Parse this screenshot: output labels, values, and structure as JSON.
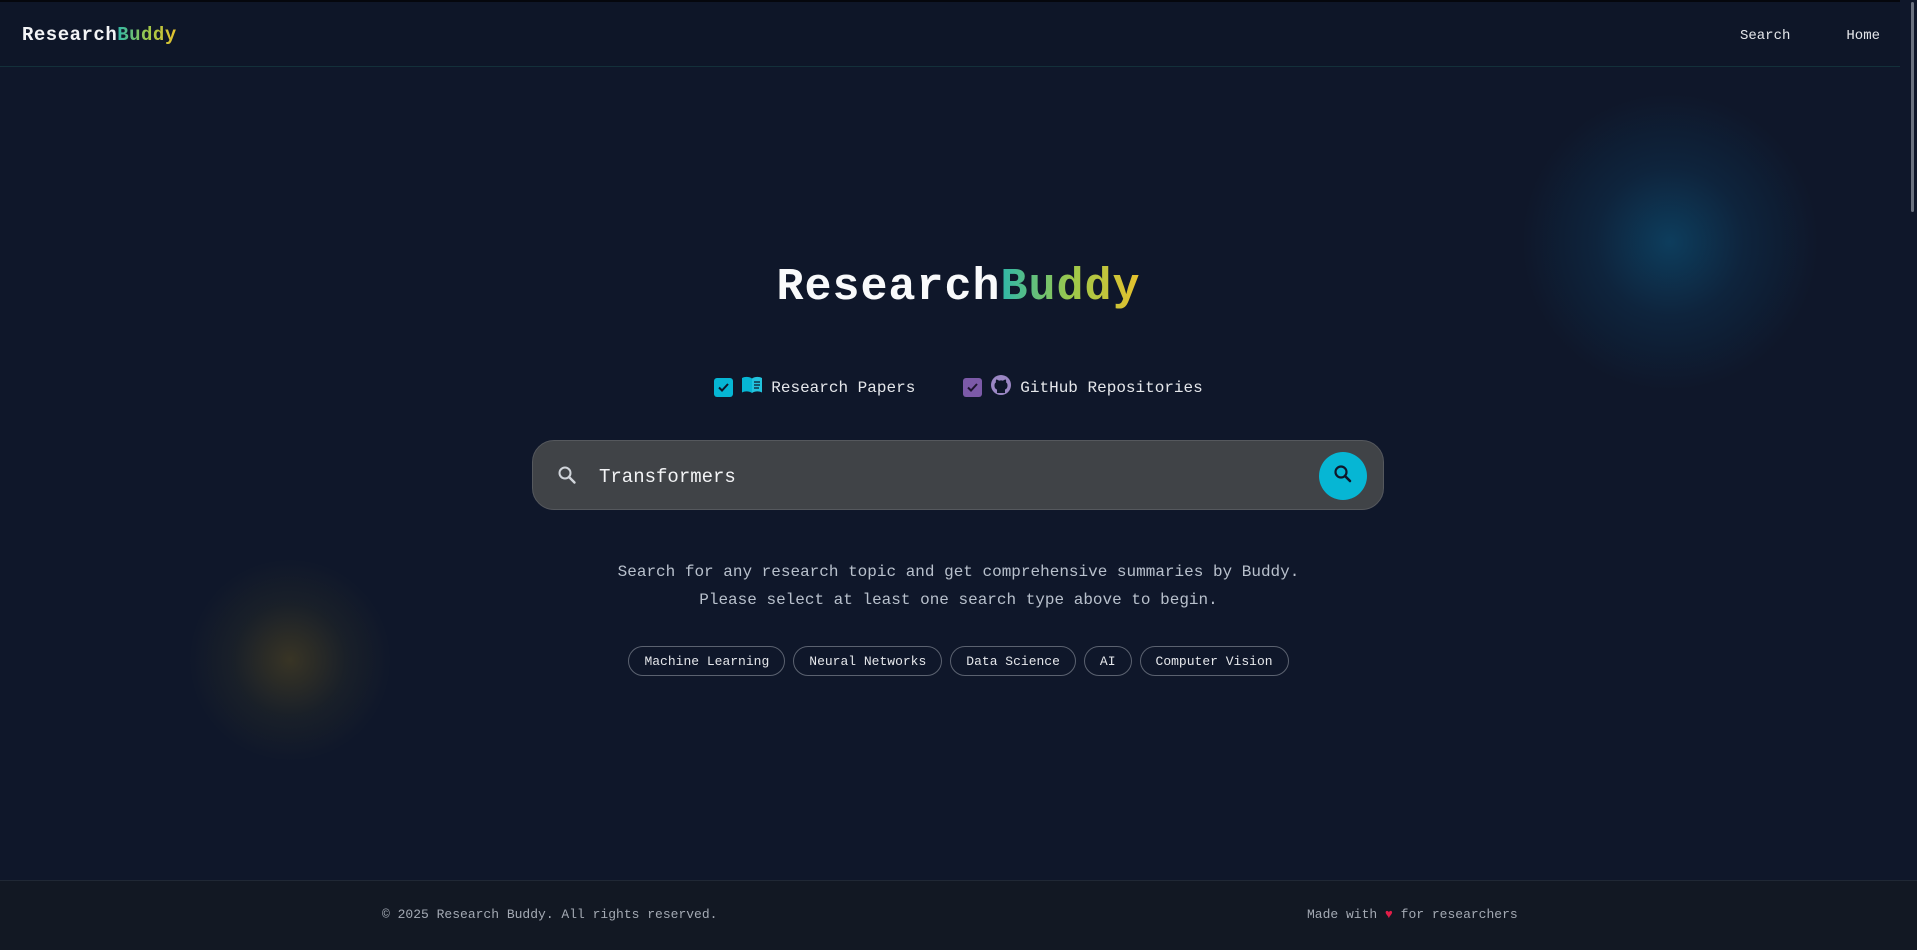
{
  "header": {
    "brand_part1": "Research",
    "brand_part2": "Buddy",
    "nav": [
      "Search",
      "Home"
    ]
  },
  "hero": {
    "title_part1": "Research",
    "title_part2": "Buddy"
  },
  "filters": [
    {
      "label": "Research Papers",
      "checked": true,
      "icon": "book-icon",
      "color": "#06b6d4"
    },
    {
      "label": "GitHub Repositories",
      "checked": true,
      "icon": "github-icon",
      "color": "#7c5aa8"
    }
  ],
  "search": {
    "value": "Transformers",
    "icon": "search-icon",
    "button_icon": "search-icon"
  },
  "description": [
    "Search for any research topic and get comprehensive summaries by Buddy.",
    "Please select at least one search type above to begin."
  ],
  "suggestions": [
    "Machine Learning",
    "Neural Networks",
    "Data Science",
    "AI",
    "Computer Vision"
  ],
  "footer": {
    "copyright": "© 2025 Research Buddy. All rights reserved.",
    "made_with_prefix": "Made with",
    "heart": "♥",
    "made_with_suffix": "for researchers"
  },
  "colors": {
    "accent": "#06b6d4",
    "background": "#0f172a",
    "purple": "#7c5aa8",
    "heart": "#e11d48"
  }
}
